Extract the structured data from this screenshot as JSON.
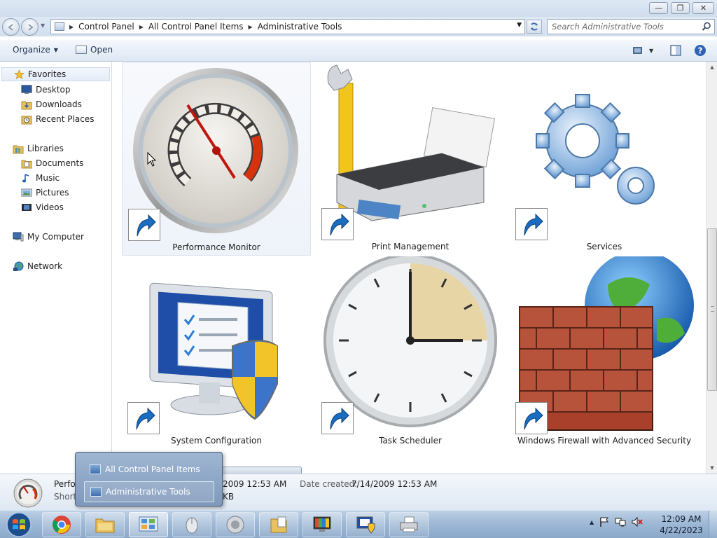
{
  "window": {
    "minimize_glyph": "—",
    "maximize_glyph": "❐",
    "close_glyph": "✕"
  },
  "address": {
    "breadcrumbs": [
      "Control Panel",
      "All Control Panel Items",
      "Administrative Tools"
    ],
    "search_placeholder": "Search Administrative Tools"
  },
  "toolbar": {
    "organize_label": "Organize",
    "open_label": "Open"
  },
  "sidebar": {
    "favorites": {
      "label": "Favorites",
      "items": [
        "Desktop",
        "Downloads",
        "Recent Places"
      ]
    },
    "libraries": {
      "label": "Libraries",
      "items": [
        "Documents",
        "Music",
        "Pictures",
        "Videos"
      ]
    },
    "my_computer": "My Computer",
    "network": "Network"
  },
  "items": [
    {
      "label": "Performance Monitor",
      "icon": "performance-monitor-icon"
    },
    {
      "label": "Print Management",
      "icon": "print-management-icon"
    },
    {
      "label": "Services",
      "icon": "services-icon"
    },
    {
      "label": "System Configuration",
      "icon": "system-configuration-icon"
    },
    {
      "label": "Task Scheduler",
      "icon": "task-scheduler-icon"
    },
    {
      "label": "Windows Firewall with Advanced Security",
      "icon": "windows-firewall-icon"
    }
  ],
  "details": {
    "name": "Perfo",
    "type": "Shorto",
    "modified": "2009 12:53 AM",
    "size": "KB",
    "created_label": "Date created:",
    "created_value": "7/14/2009 12:53 AM"
  },
  "dropdown": {
    "items": [
      "All Control Panel Items",
      "Administrative Tools"
    ]
  },
  "clock": {
    "time": "12:09 AM",
    "date": "4/22/2023"
  },
  "colors": {
    "accent": "#3a6fb5",
    "taskbar": "#9fb9d6"
  }
}
